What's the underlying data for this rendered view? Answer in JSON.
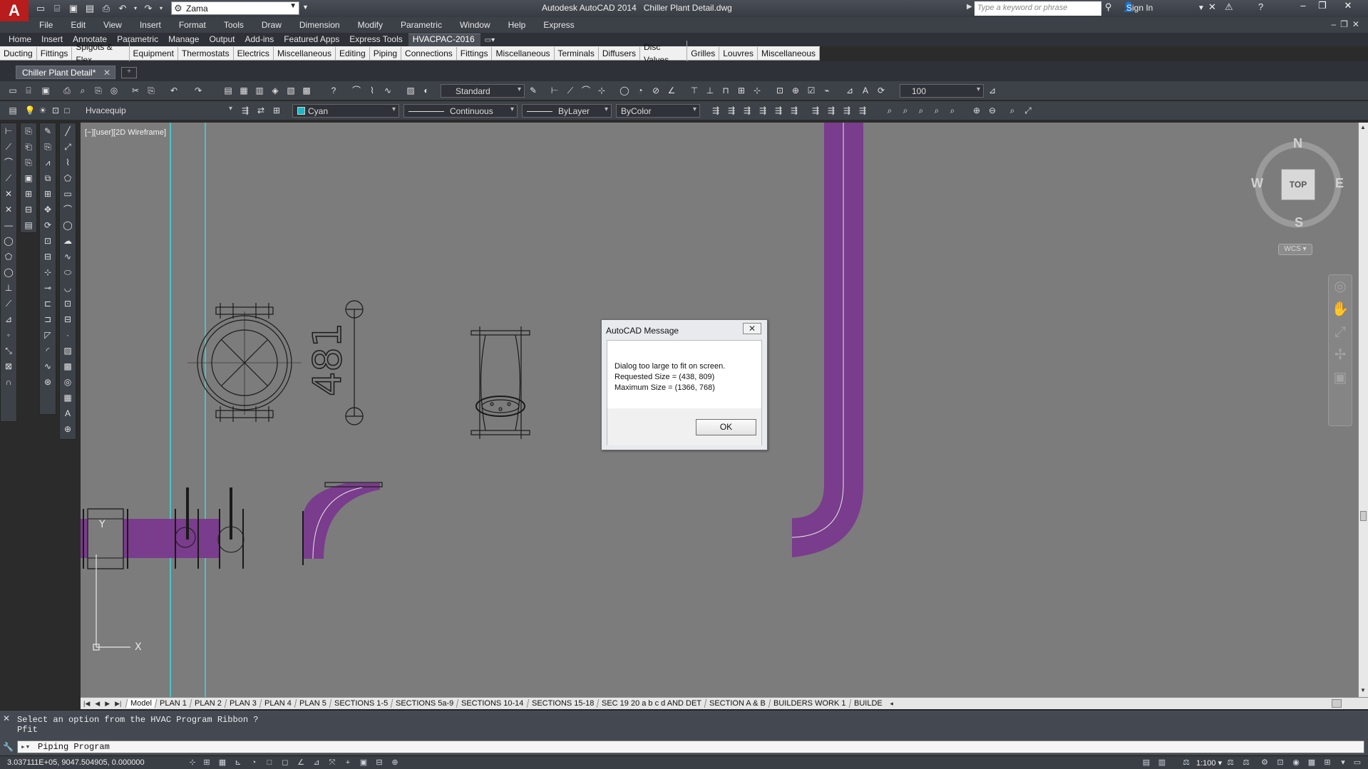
{
  "app": {
    "title": "Autodesk AutoCAD 2014",
    "filename": "Chiller Plant Detail.dwg",
    "logo": "A",
    "workspace": "Zama",
    "search_placeholder": "Type a keyword or phrase",
    "sign_in": "Sign In"
  },
  "menubar": [
    "File",
    "Edit",
    "View",
    "Insert",
    "Format",
    "Tools",
    "Draw",
    "Dimension",
    "Modify",
    "Parametric",
    "Window",
    "Help",
    "Express"
  ],
  "ribbon_tabs": [
    "Home",
    "Insert",
    "Annotate",
    "Parametric",
    "Manage",
    "Output",
    "Add-ins",
    "Featured Apps",
    "Express Tools",
    "HVACPAC-2016"
  ],
  "ribbon_active_tab": "HVACPAC-2016",
  "hvac_panels": [
    "Ducting",
    "Fittings",
    "Spigots & Flex",
    "Equipment",
    "Thermostats",
    "Electrics",
    "Miscellaneous",
    "Editing",
    "Piping",
    "Connections",
    "Fittings",
    "Miscellaneous",
    "Terminals",
    "Diffusers",
    "Disc Valves",
    "Grilles",
    "Louvres",
    "Miscellaneous"
  ],
  "document_tab": "Chiller Plant Detail*",
  "toolbar": {
    "text_style": "Standard",
    "scale_value": "100",
    "layer": "Hvacequip",
    "color": "Cyan",
    "color_hex": "#19b8c7",
    "linetype": "Continuous",
    "lineweight": "ByLayer",
    "plotstyle": "ByColor"
  },
  "viewport_label": "[−][user][2D Wireframe]",
  "viewcube": {
    "north": "N",
    "south": "S",
    "east": "E",
    "west": "W",
    "face": "TOP",
    "wcs": "WCS"
  },
  "drawing": {
    "dimension_text": "481",
    "ucs_x": "X",
    "ucs_y": "Y",
    "pipe_color": "#7a3c8c",
    "cyan_line_color": "#3fd6d6"
  },
  "dialog": {
    "title": "AutoCAD Message",
    "line1": "Dialog too large to fit on screen.",
    "line2": "Requested Size = (438, 809)",
    "line3": "Maximum Size = (1366, 768)",
    "ok": "OK"
  },
  "layout_tabs": [
    "Model",
    "PLAN 1",
    "PLAN 2",
    "PLAN 3",
    "PLAN 4",
    "PLAN 5",
    "SECTIONS 1-5",
    "SECTIONS 5a-9",
    "SECTIONS 10-14",
    "SECTIONS 15-18",
    "SEC 19 20 a b c d AND DET",
    "SECTION A & B",
    "BUILDERS WORK 1",
    "BUILDE"
  ],
  "active_layout": "Model",
  "command": {
    "history": [
      "Select an option from the HVAC Program Ribbon ?",
      "Pfit"
    ],
    "input": "Piping Program"
  },
  "status": {
    "coordinates": "3.037111E+05, 9047.504905, 0.000000",
    "annotation_scale": "1:100"
  }
}
